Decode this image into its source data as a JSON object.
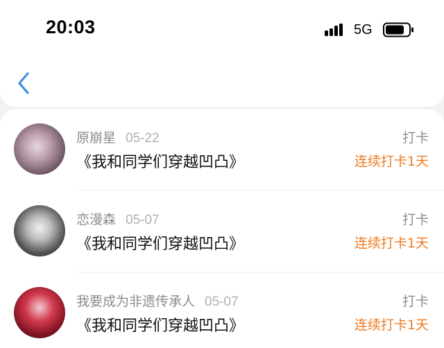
{
  "status_bar": {
    "time": "20:03",
    "network": "5G"
  },
  "nav": {
    "back_icon": "chevron-left-icon",
    "accent": "#3a8ee6"
  },
  "colors": {
    "streak": "#f07a1e",
    "muted": "#8c8c8c"
  },
  "entries": [
    {
      "user": "原崩星",
      "date": "05-22",
      "title": "《我和同学们穿越凹凸》",
      "action": "打卡",
      "streak": "连续打卡1天"
    },
    {
      "user": "恋漫森",
      "date": "05-07",
      "title": "《我和同学们穿越凹凸》",
      "action": "打卡",
      "streak": "连续打卡1天"
    },
    {
      "user": "我要成为非遗传承人",
      "date": "05-07",
      "title": "《我和同学们穿越凹凸》",
      "action": "打卡",
      "streak": "连续打卡1天"
    }
  ]
}
